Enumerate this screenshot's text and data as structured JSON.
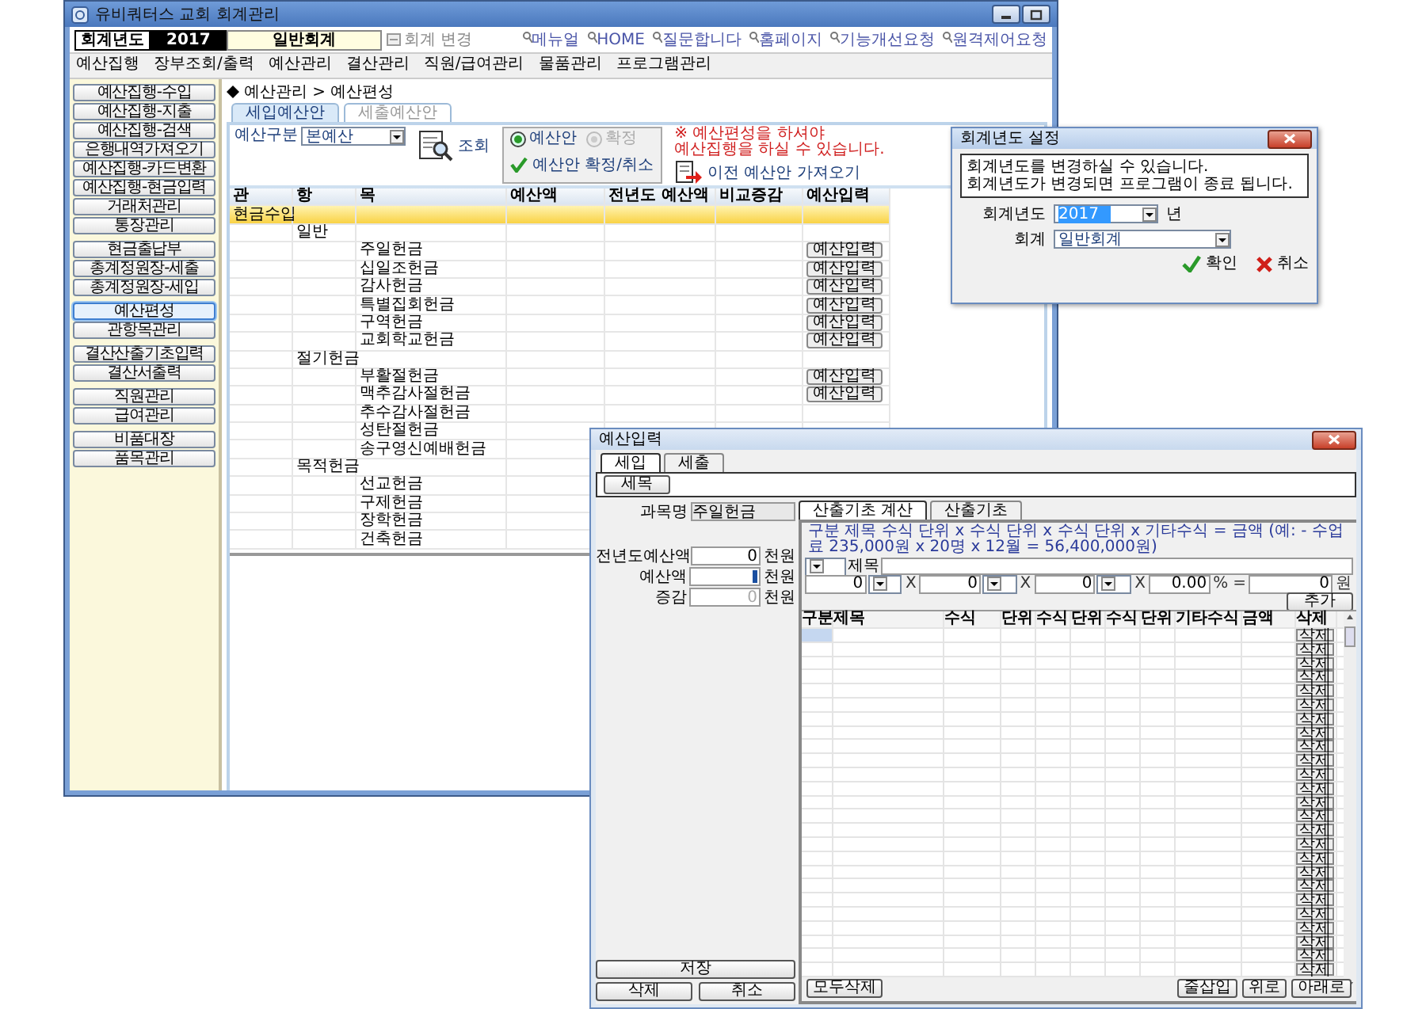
{
  "main_window": {
    "title": "유비쿼터스 교회 회계관리",
    "year_label": "회계년도",
    "year": "2017",
    "account": "일반회계",
    "change_link": "회계 변경",
    "links": [
      "메뉴얼",
      "HOME",
      "질문합니다",
      "홈페이지",
      "기능개선요청",
      "원격제어요청"
    ],
    "menu": [
      "예산집행",
      "장부조회/출력",
      "예산관리",
      "결산관리",
      "직원/급여관리",
      "물품관리",
      "프로그램관리"
    ],
    "sidebar": [
      [
        {
          "label": "예산집행-수입",
          "selected": false
        },
        {
          "label": "예산집행-지출",
          "selected": false
        },
        {
          "label": "예산집행-검색",
          "selected": false
        },
        {
          "label": "은행내역가져오기",
          "selected": false
        },
        {
          "label": "예산집행-카드변환",
          "selected": false
        },
        {
          "label": "예산집행-현금입력",
          "selected": false
        },
        {
          "label": "거래처관리",
          "selected": false
        },
        {
          "label": "통장관리",
          "selected": false
        }
      ],
      [
        {
          "label": "현금출납부",
          "selected": false
        },
        {
          "label": "총계정원장-세출",
          "selected": false
        },
        {
          "label": "총계정원장-세입",
          "selected": false
        }
      ],
      [
        {
          "label": "예산편성",
          "selected": true
        },
        {
          "label": "관항목관리",
          "selected": false
        }
      ],
      [
        {
          "label": "결산산출기초입력",
          "selected": false
        },
        {
          "label": "결산서출력",
          "selected": false
        }
      ],
      [
        {
          "label": "직원관리",
          "selected": false
        },
        {
          "label": "급여관리",
          "selected": false
        }
      ],
      [
        {
          "label": "비품대장",
          "selected": false
        },
        {
          "label": "품목관리",
          "selected": false
        }
      ]
    ],
    "breadcrumb": "예산관리 > 예산편성",
    "tabs": [
      {
        "label": "세입예산안",
        "selected": true
      },
      {
        "label": "세출예산안",
        "selected": false
      }
    ],
    "budget_type": {
      "label": "예산구분",
      "value": "본예산"
    },
    "search_button": "조회",
    "modes": [
      {
        "label": "예산안",
        "selected": true
      },
      {
        "label": "확정",
        "selected": false
      }
    ],
    "confirm_button": "예산안 확정/취소",
    "notice": "※ 예산편성을 하셔야\n예산집행을 하실 수 있습니다.",
    "import_button": "이전 예산안 가져오기",
    "table": {
      "columns": [
        "관",
        "항",
        "목",
        "예산액",
        "전년도 예산액",
        "비교증감",
        "예산입력"
      ],
      "rows": [
        {
          "name": "현금수입",
          "selected": true,
          "children": [
            {
              "name": "일반",
              "selected": false,
              "children": [
                {
                  "name": "주일헌금",
                  "selected": false,
                  "button": "예산입력"
                },
                {
                  "name": "십일조헌금",
                  "selected": false,
                  "button": "예산입력"
                },
                {
                  "name": "감사헌금",
                  "selected": false,
                  "button": "예산입력"
                },
                {
                  "name": "특별집회헌금",
                  "selected": false,
                  "button": "예산입력"
                },
                {
                  "name": "구역헌금",
                  "selected": false,
                  "button": "예산입력"
                },
                {
                  "name": "교회학교헌금",
                  "selected": false,
                  "button": "예산입력"
                }
              ]
            },
            {
              "name": "절기헌금",
              "selected": false,
              "children": [
                {
                  "name": "부활절헌금",
                  "selected": false,
                  "button": "예산입력"
                },
                {
                  "name": "맥추감사절헌금",
                  "selected": false,
                  "button": "예산입력"
                },
                {
                  "name": "추수감사절헌금",
                  "selected": false
                },
                {
                  "name": "성탄절헌금",
                  "selected": false
                },
                {
                  "name": "송구영신예배헌금",
                  "selected": false
                }
              ]
            },
            {
              "name": "목적헌금",
              "selected": false,
              "children": [
                {
                  "name": "선교헌금",
                  "selected": false
                },
                {
                  "name": "구제헌금",
                  "selected": false
                },
                {
                  "name": "장학헌금",
                  "selected": false
                },
                {
                  "name": "건축헌금",
                  "selected": false
                }
              ]
            }
          ]
        }
      ]
    }
  },
  "settings_dialog": {
    "title": "회계년도 설정",
    "message": "회계년도를 변경하실 수 있습니다.\n회계년도가 변경되면 프로그램이 종료 됩니다.",
    "year": {
      "label": "회계년도",
      "value": "2017",
      "text_selected": true,
      "unit": "년"
    },
    "account": {
      "label": "회계",
      "value": "일반회계"
    },
    "ok_button": "확인",
    "cancel_button": "취소"
  },
  "input_dialog": {
    "title": "예산입력",
    "tabs": [
      {
        "label": "세입",
        "selected": true
      },
      {
        "label": "세출",
        "selected": false
      }
    ],
    "sub_button": "세목",
    "subject": {
      "label": "과목명",
      "value": "주일헌금"
    },
    "amounts": [
      {
        "label": "전년도예산액",
        "value": "0",
        "unit": "천원",
        "focused": false,
        "disabled": false
      },
      {
        "label": "예산액",
        "unit": "천원",
        "focused": true,
        "disabled": false
      },
      {
        "label": "증감",
        "value": "0",
        "unit": "천원",
        "focused": false,
        "disabled": true
      }
    ],
    "save_button": "저장",
    "delete_button": "삭제",
    "cancel_button": "취소",
    "calc_tabs": [
      {
        "label": "산출기초 계산",
        "selected": true
      },
      {
        "label": "산출기초",
        "selected": false
      }
    ],
    "hint": "구분 제목   수식 단위 x 수식 단위 x 수식 단위 x 기타수식 = 금액 (예: - 수업료  235,000원 x 20명 x 12월 = 56,400,000원)",
    "title_label": "제목",
    "formula": [
      {
        "kind": "number",
        "value": "0"
      },
      {
        "kind": "unit"
      },
      {
        "kind": "op",
        "text": "X"
      },
      {
        "kind": "number",
        "value": "0"
      },
      {
        "kind": "unit"
      },
      {
        "kind": "op",
        "text": "X"
      },
      {
        "kind": "number",
        "value": "0"
      },
      {
        "kind": "unit"
      },
      {
        "kind": "op",
        "text": "X"
      },
      {
        "kind": "number",
        "value": "0.00"
      },
      {
        "kind": "op",
        "text": "%"
      },
      {
        "kind": "op",
        "text": "="
      },
      {
        "kind": "total",
        "value": "0"
      },
      {
        "kind": "op",
        "text": "원"
      }
    ],
    "add_button": "추가",
    "grid": {
      "columns": [
        "구분",
        "제목",
        "수식",
        "단위",
        "수식",
        "단위",
        "수식",
        "단위",
        "기타수식",
        "금액",
        "삭제"
      ],
      "rows": [
        {
          "selected": true,
          "delete": "삭제"
        },
        {
          "selected": false,
          "delete": "삭제"
        },
        {
          "selected": false,
          "delete": "삭제"
        },
        {
          "selected": false,
          "delete": "삭제"
        },
        {
          "selected": false,
          "delete": "삭제"
        },
        {
          "selected": false,
          "delete": "삭제"
        },
        {
          "selected": false,
          "delete": "삭제"
        },
        {
          "selected": false,
          "delete": "삭제"
        },
        {
          "selected": false,
          "delete": "삭제"
        },
        {
          "selected": false,
          "delete": "삭제"
        },
        {
          "selected": false,
          "delete": "삭제"
        },
        {
          "selected": false,
          "delete": "삭제"
        },
        {
          "selected": false,
          "delete": "삭제"
        },
        {
          "selected": false,
          "delete": "삭제"
        },
        {
          "selected": false,
          "delete": "삭제"
        },
        {
          "selected": false,
          "delete": "삭제"
        },
        {
          "selected": false,
          "delete": "삭제"
        },
        {
          "selected": false,
          "delete": "삭제"
        },
        {
          "selected": false,
          "delete": "삭제"
        },
        {
          "selected": false,
          "delete": "삭제"
        },
        {
          "selected": false,
          "delete": "삭제"
        },
        {
          "selected": false,
          "delete": "삭제"
        },
        {
          "selected": false,
          "delete": "삭제"
        },
        {
          "selected": false,
          "delete": "삭제"
        },
        {
          "selected": false,
          "delete": "삭제"
        }
      ]
    },
    "bottom_buttons": [
      "모두삭제",
      "줄삽입",
      "위로",
      "아래로"
    ]
  }
}
